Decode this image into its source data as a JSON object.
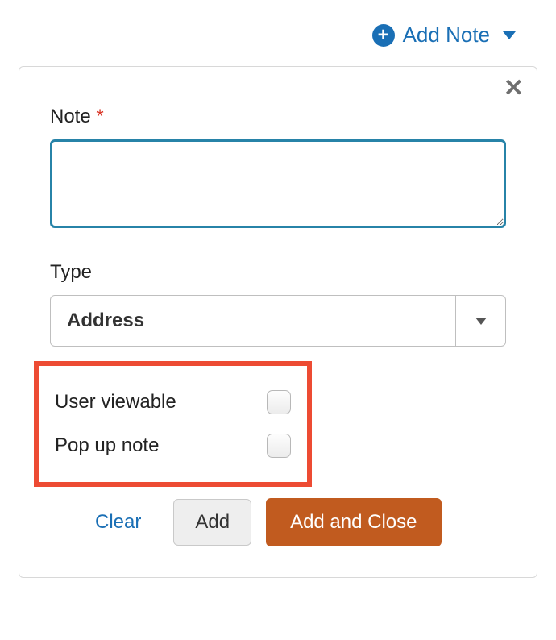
{
  "header": {
    "add_note_label": "Add Note"
  },
  "panel": {
    "note_label": "Note",
    "required_mark": "*",
    "note_value": "",
    "type_label": "Type",
    "type_selected": "Address",
    "user_viewable_label": "User viewable",
    "popup_note_label": "Pop up note",
    "buttons": {
      "clear": "Clear",
      "add": "Add",
      "add_close": "Add and Close"
    }
  }
}
